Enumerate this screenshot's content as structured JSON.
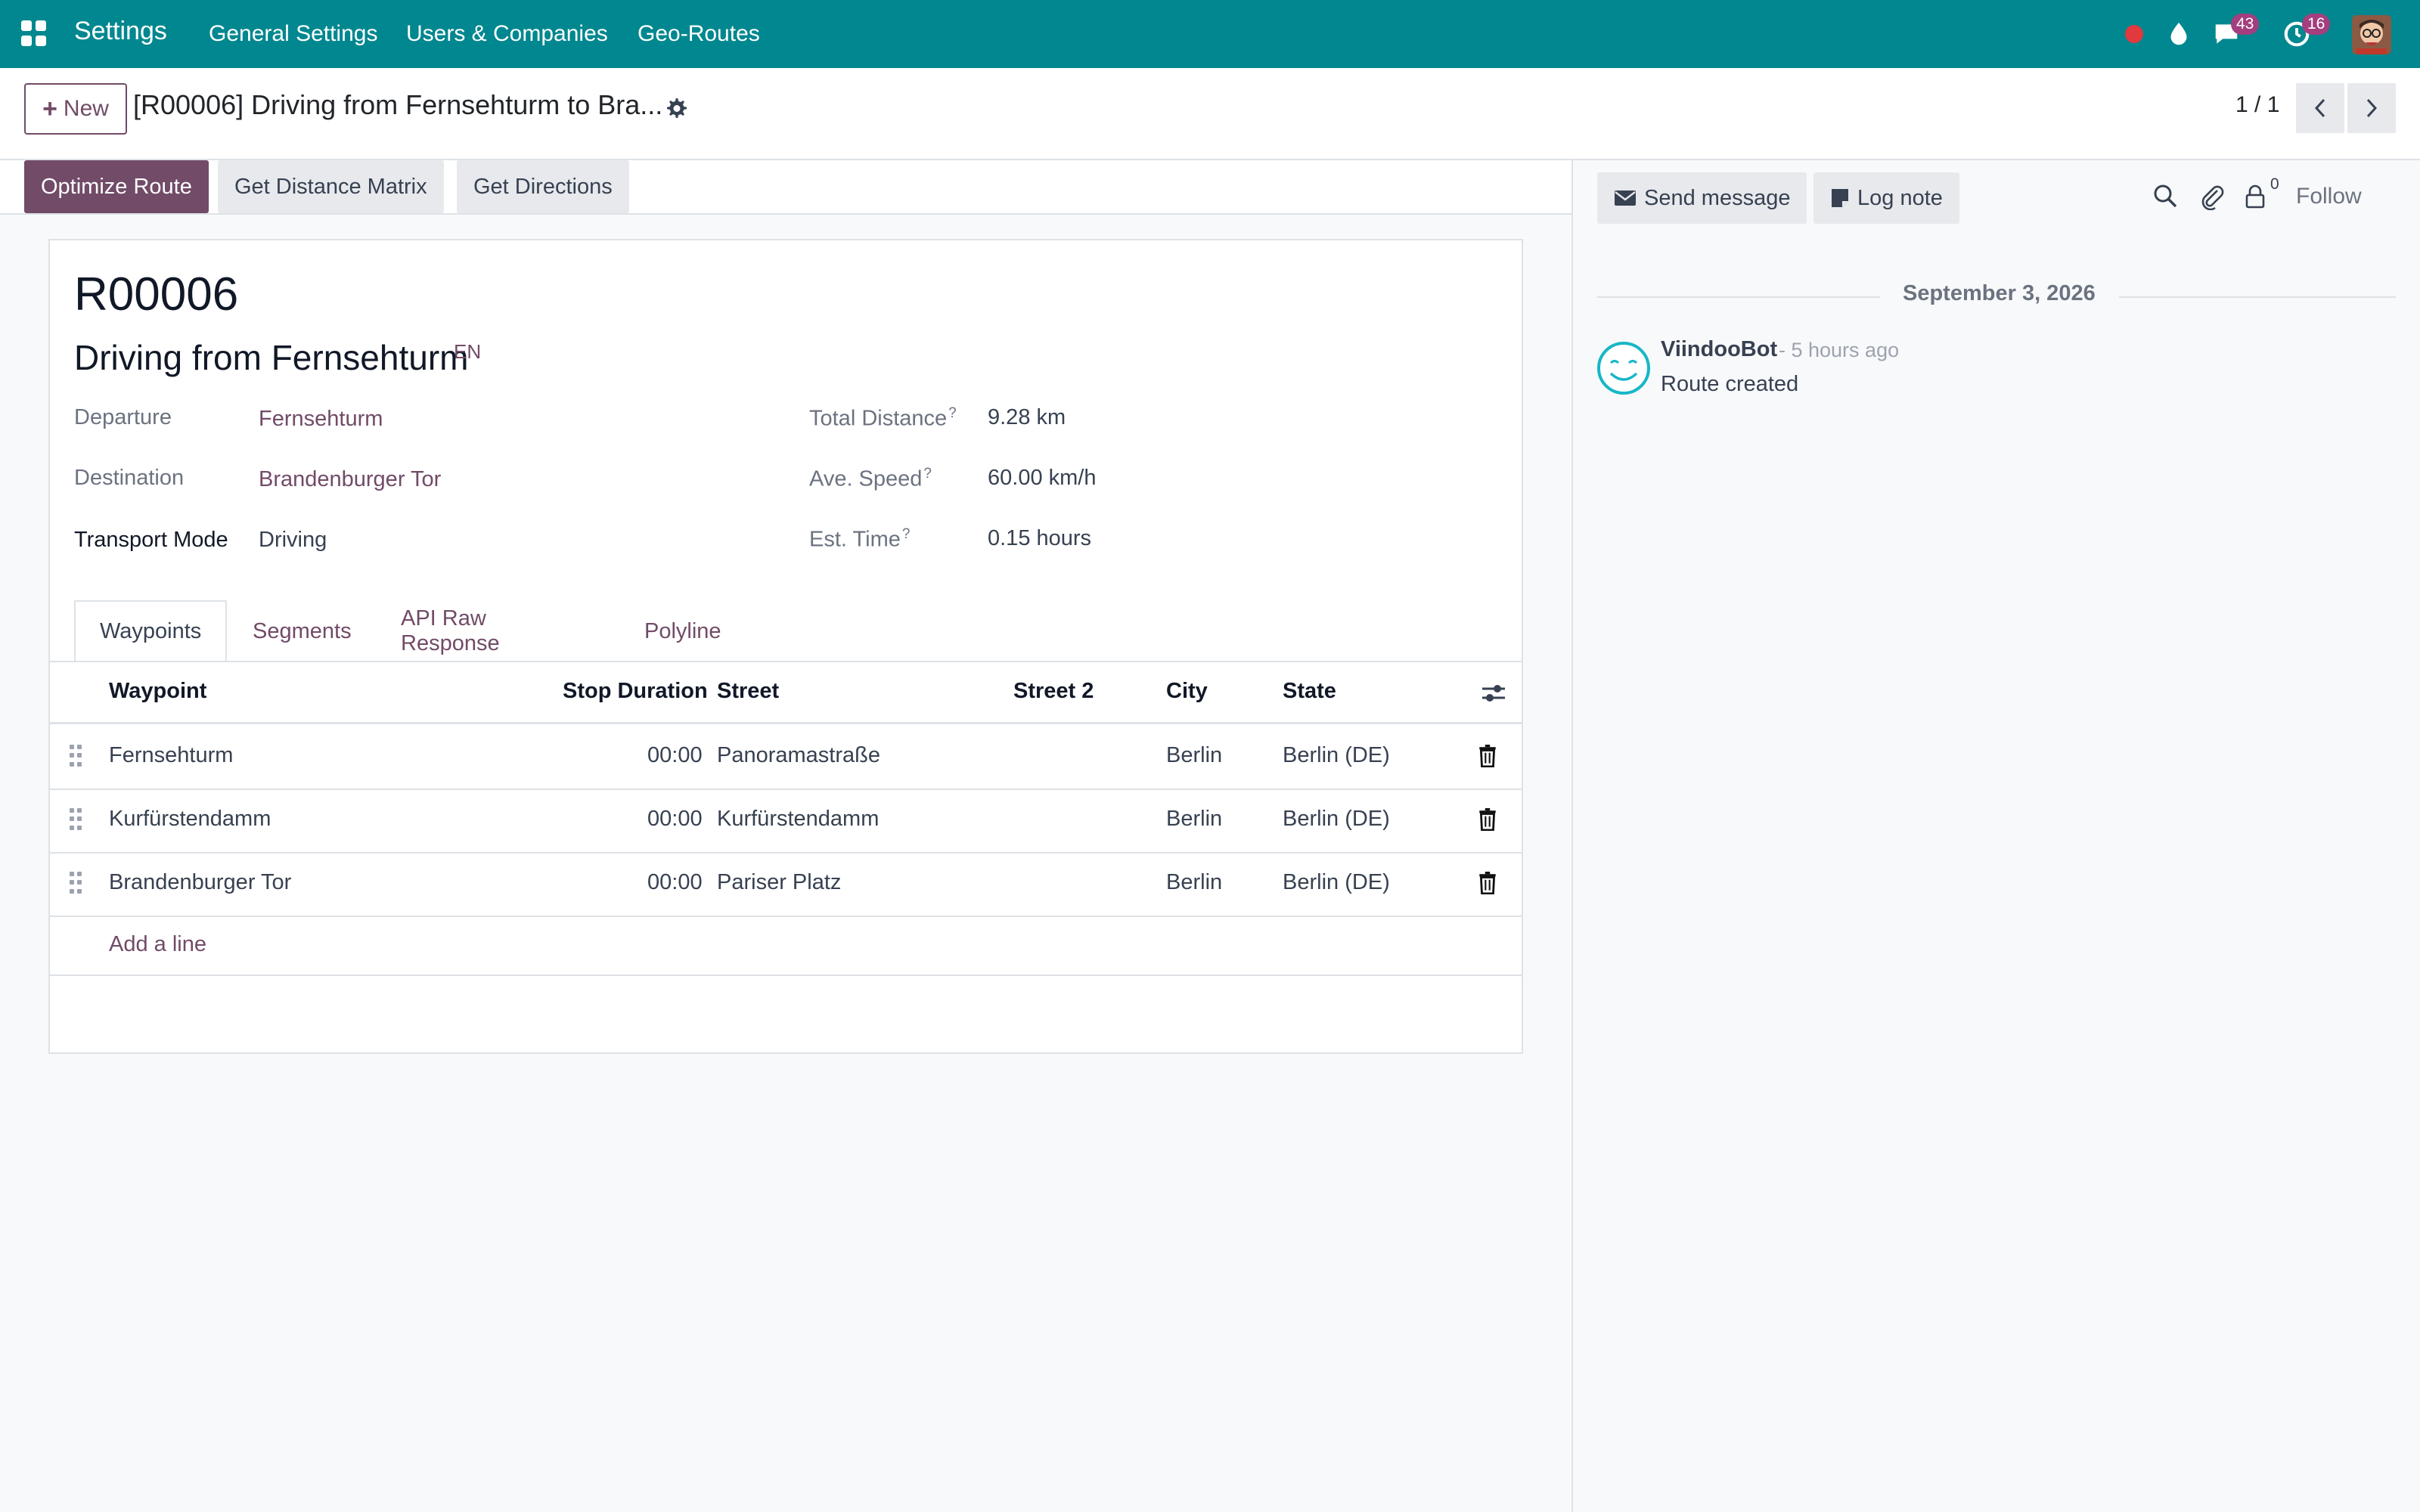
{
  "navbar": {
    "app_name": "Settings",
    "menu": [
      "General Settings",
      "Users & Companies",
      "Geo-Routes"
    ],
    "messages_badge": "43",
    "activities_badge": "16",
    "colors": {
      "bar": "#01878f",
      "badge": "#a43e7e",
      "recording": "#e0393e"
    }
  },
  "control_panel": {
    "new_label": "New",
    "breadcrumb": "[R00006] Driving from Fernsehturm to Bra...",
    "pager": "1 / 1"
  },
  "statusbar": {
    "buttons": [
      "Optimize Route",
      "Get Distance Matrix",
      "Get Directions"
    ]
  },
  "record": {
    "reference": "R00006",
    "name": "Driving from Fernsehturm",
    "lang": "EN",
    "fields": {
      "departure_label": "Departure",
      "departure_value": "Fernsehturm",
      "destination_label": "Destination",
      "destination_value": "Brandenburger Tor",
      "transport_label": "Transport Mode",
      "transport_value": "Driving",
      "distance_label": "Total Distance",
      "distance_value": "9.28 km",
      "speed_label": "Ave. Speed",
      "speed_value": "60.00 km/h",
      "time_label": "Est. Time",
      "time_value": "0.15 hours",
      "help_mark": "?"
    }
  },
  "tabs": [
    "Waypoints",
    "Segments",
    "API Raw Response",
    "Polyline"
  ],
  "waypoints": {
    "columns": [
      "Waypoint",
      "Stop Duration",
      "Street",
      "Street 2",
      "City",
      "State"
    ],
    "rows": [
      {
        "waypoint": "Fernsehturm",
        "duration": "00:00",
        "street": "Panoramastraße",
        "street2": "",
        "city": "Berlin",
        "state": "Berlin (DE)"
      },
      {
        "waypoint": "Kurfürstendamm",
        "duration": "00:00",
        "street": "Kurfürstendamm",
        "street2": "",
        "city": "Berlin",
        "state": "Berlin (DE)"
      },
      {
        "waypoint": "Brandenburger Tor",
        "duration": "00:00",
        "street": "Pariser Platz",
        "street2": "",
        "city": "Berlin",
        "state": "Berlin (DE)"
      }
    ],
    "add_line": "Add a line"
  },
  "chatter": {
    "send_message": "Send message",
    "log_note": "Log note",
    "followers_count": "0",
    "follow": "Follow",
    "date": "September 3, 2026",
    "message": {
      "author": "ViindooBot",
      "time": "- 5 hours ago",
      "body": "Route created"
    }
  },
  "accent": "#714b67"
}
